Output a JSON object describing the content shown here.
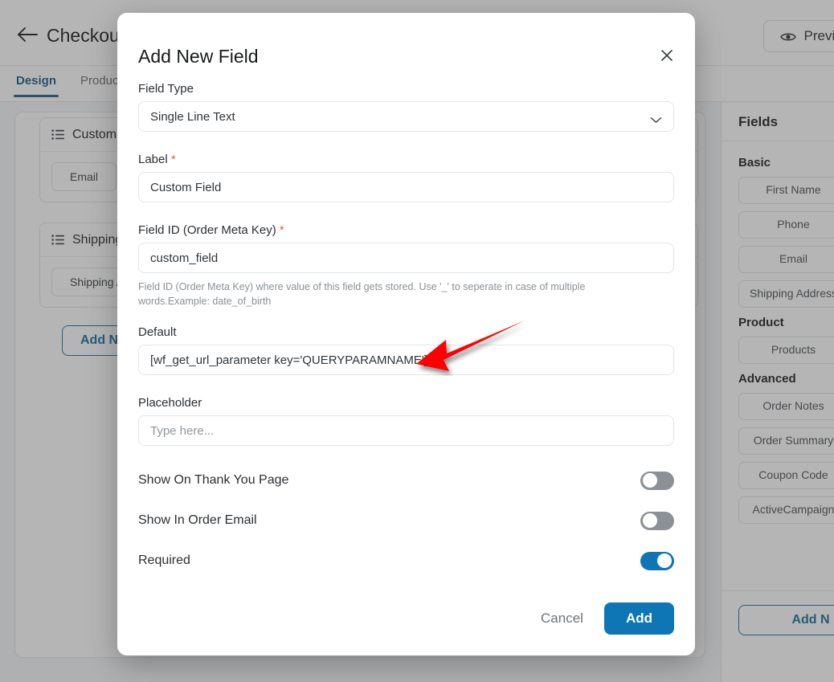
{
  "app": {
    "title": "Checkout",
    "back_icon": "back-arrow-icon",
    "preview_label": "Preview",
    "preview_icon": "eye-icon",
    "tabs": [
      {
        "label": "Design",
        "active": true
      },
      {
        "label": "Produc",
        "active": false
      }
    ]
  },
  "canvas": {
    "sections": [
      {
        "icon": "list-icon",
        "title": "Custome",
        "chips": [
          "Email",
          ""
        ]
      },
      {
        "icon": "list-icon",
        "title": "Shipping",
        "chips": [
          "Shipping Ad"
        ]
      }
    ],
    "add_section_label": "Add New S"
  },
  "fields_panel": {
    "title": "Fields",
    "groups": [
      {
        "title": "Basic",
        "items": [
          "First Name",
          "Phone",
          "Email",
          "Shipping Address"
        ]
      },
      {
        "title": "Product",
        "items": [
          "Products"
        ]
      },
      {
        "title": "Advanced",
        "items": [
          "Order Notes",
          "Order Summary",
          "Coupon Code",
          "ActiveCampaign"
        ]
      }
    ],
    "add_field_label": "Add N"
  },
  "modal": {
    "title": "Add New Field",
    "close_icon": "close-icon",
    "field_type": {
      "label": "Field Type",
      "value": "Single Line Text",
      "chevron_icon": "chevron-down-icon"
    },
    "label_field": {
      "label": "Label",
      "required_marker": "*",
      "value": "Custom Field"
    },
    "field_id": {
      "label": "Field ID (Order Meta Key)",
      "required_marker": "*",
      "value": "custom_field",
      "help": "Field ID (Order Meta Key) where value of this field gets stored. Use '_' to seperate in case of multiple words.Example: date_of_birth"
    },
    "default_field": {
      "label": "Default",
      "value": "[wf_get_url_parameter key='QUERYPARAMNAME']"
    },
    "placeholder_field": {
      "label": "Placeholder",
      "value": "",
      "placeholder": "Type here..."
    },
    "toggles": [
      {
        "label": "Show On Thank You Page",
        "on": false
      },
      {
        "label": "Show In Order Email",
        "on": false
      },
      {
        "label": "Required",
        "on": true
      }
    ],
    "cancel_label": "Cancel",
    "add_label": "Add"
  },
  "annotation": {
    "arrow_color": "#FF0000",
    "points_to": "default-field-input"
  },
  "colors": {
    "accent_blue": "#0f76b5",
    "tab_active": "#1b5e8c",
    "required_star": "#e8604c",
    "annotation_red": "#FF0000"
  }
}
